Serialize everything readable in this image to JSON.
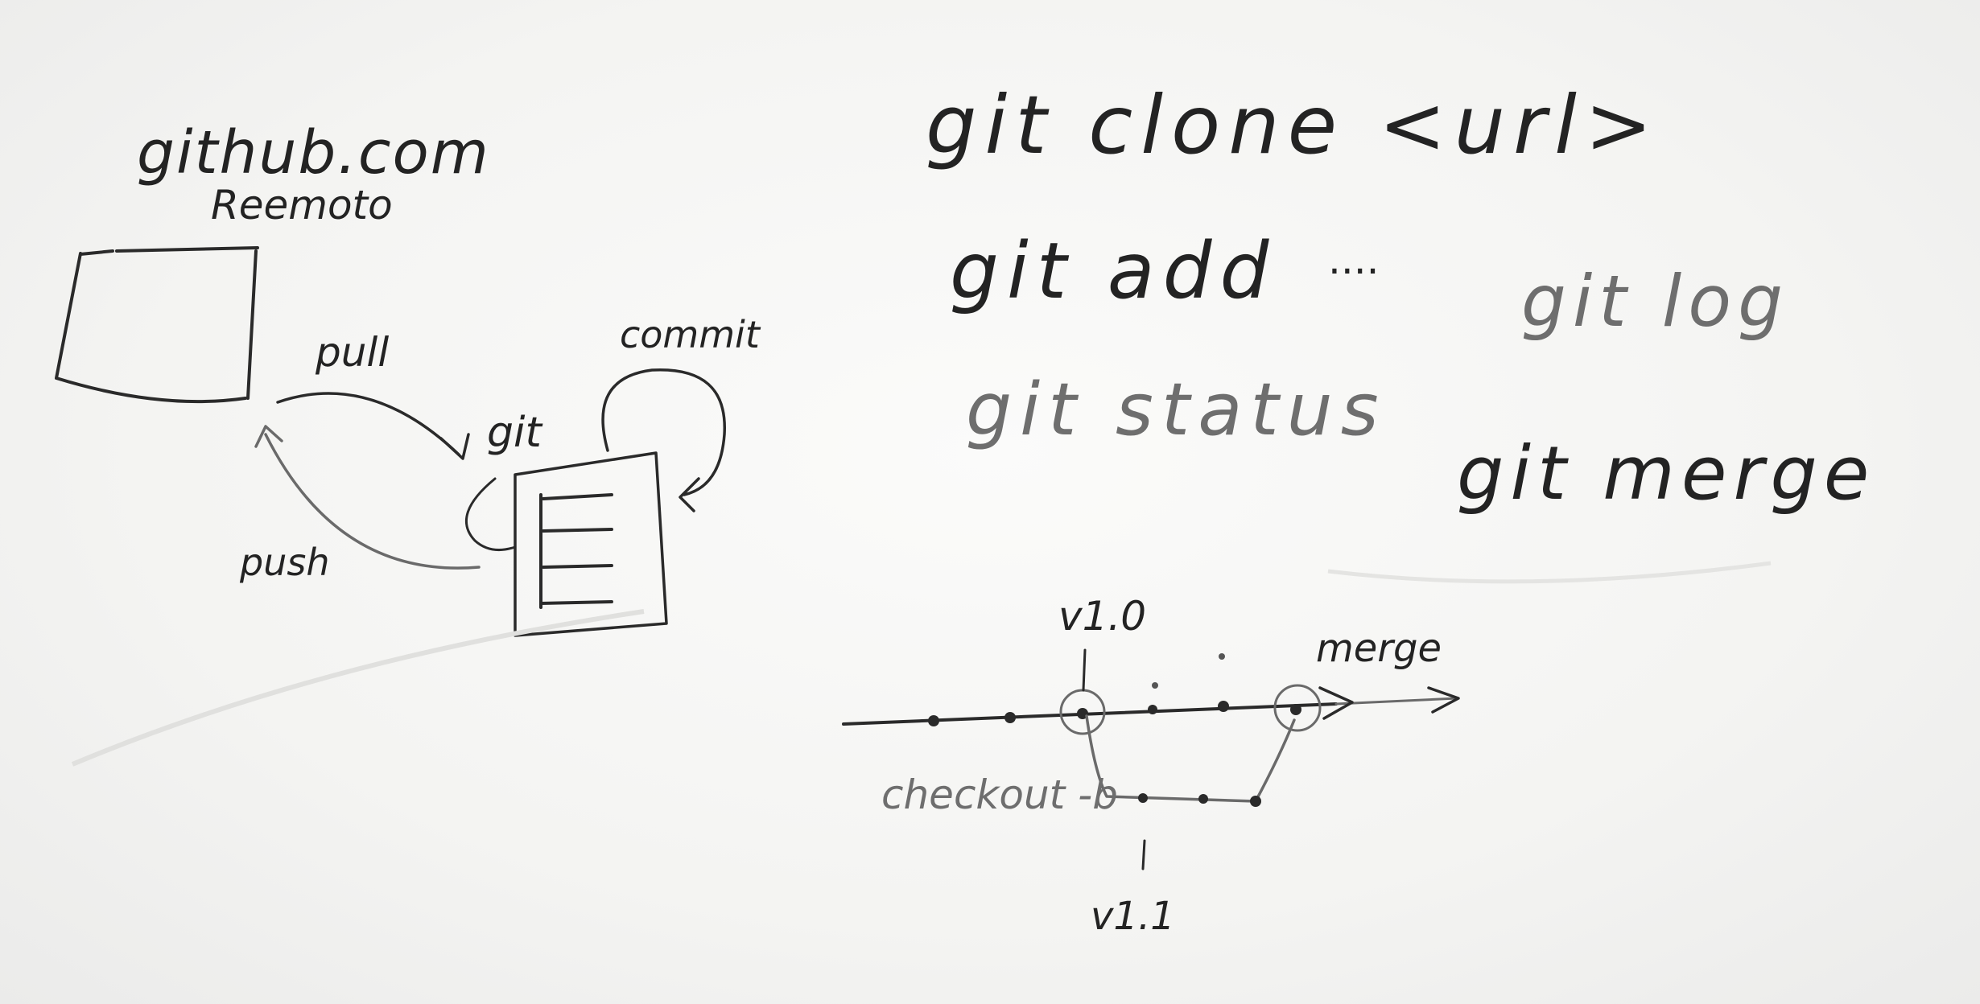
{
  "left": {
    "site": "github.com",
    "remote_label": "Reemoto",
    "pull_label": "pull",
    "push_label": "push",
    "commit_label": "commit",
    "git_label": "git"
  },
  "commands": {
    "clone": "git clone <url>",
    "add": "git add",
    "add_dots": "....",
    "log": "git log",
    "status": "git status",
    "merge": "git merge"
  },
  "branch": {
    "tag_v10": "v1.0",
    "merge_label": "merge",
    "checkout_label": "checkout -b",
    "tag_v11": "v1.1"
  }
}
